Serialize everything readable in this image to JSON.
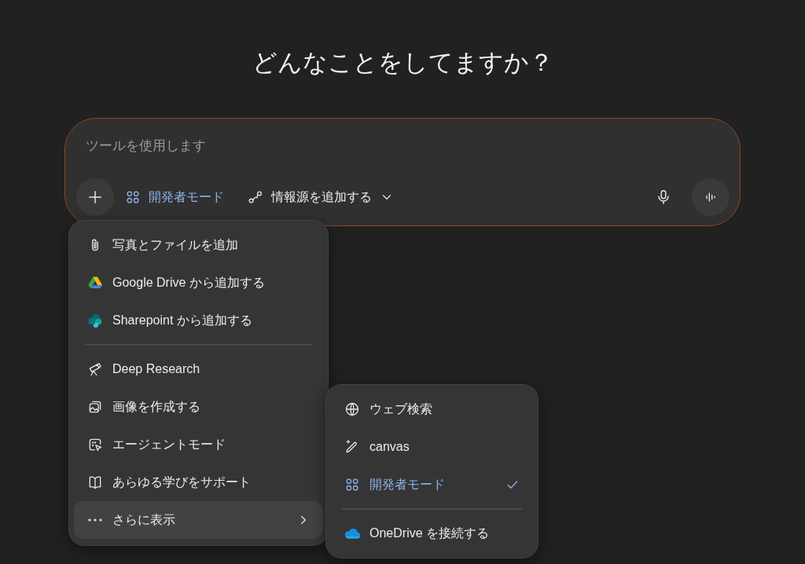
{
  "heading": "どんなことをしてますか？",
  "composer": {
    "placeholder": "ツールを使用します",
    "mode_chip": {
      "label": "開発者モード"
    },
    "sources_button": {
      "label": "情報源を追加する"
    }
  },
  "add_menu": {
    "groups": [
      [
        {
          "label": "写真とファイルを追加",
          "kind": "action",
          "highlighted": false
        },
        {
          "label": "Google Drive から追加する",
          "kind": "action",
          "highlighted": false
        },
        {
          "label": "Sharepoint から追加する",
          "kind": "action",
          "highlighted": false
        }
      ],
      [
        {
          "label": "Deep Research",
          "kind": "action",
          "highlighted": false
        },
        {
          "label": "画像を作成する",
          "kind": "action",
          "highlighted": false
        },
        {
          "label": "エージェントモード",
          "kind": "action",
          "highlighted": false
        },
        {
          "label": "あらゆる学びをサポート",
          "kind": "action",
          "highlighted": false
        },
        {
          "label": "さらに表示",
          "kind": "submenu",
          "highlighted": true
        }
      ]
    ]
  },
  "more_menu": {
    "groups": [
      [
        {
          "label": "ウェブ検索",
          "selected": false
        },
        {
          "label": "canvas",
          "selected": false
        },
        {
          "label": "開発者モード",
          "selected": true
        }
      ],
      [
        {
          "label": "OneDrive を接続する",
          "selected": false
        }
      ]
    ]
  }
}
